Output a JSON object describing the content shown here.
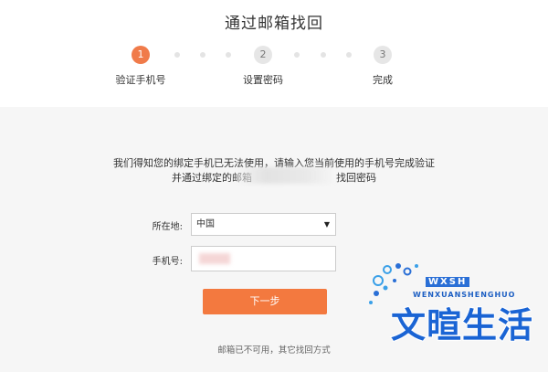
{
  "page_title": "通过邮箱找回",
  "steps": [
    {
      "number": "1",
      "label": "验证手机号",
      "state": "active"
    },
    {
      "number": "2",
      "label": "设置密码",
      "state": "inactive"
    },
    {
      "number": "3",
      "label": "完成",
      "state": "inactive"
    }
  ],
  "description": {
    "line1": "我们得知您的绑定手机已无法使用，请输入您当前使用的手机号完成验证",
    "line2_prefix": "并通过绑定的邮箱",
    "line2_suffix": "找回密码"
  },
  "form": {
    "location_label": "所在地:",
    "location_value": "中国",
    "phone_label": "手机号:"
  },
  "next_button_label": "下一步",
  "other_methods_link": "邮箱已不可用，其它找回方式",
  "watermark": {
    "small_text": "WXSH",
    "english_text": "WENXUANSHENGHUO",
    "chinese_text": "文暄生活"
  },
  "colors": {
    "accent": "#f3793f",
    "active_step": "#f07b4a",
    "inactive_step": "#e6e6e6",
    "panel_bg": "#f6f6f6",
    "watermark_blue": "#1a64d4"
  },
  "icons": {
    "select_arrow": "caret-down-icon"
  }
}
